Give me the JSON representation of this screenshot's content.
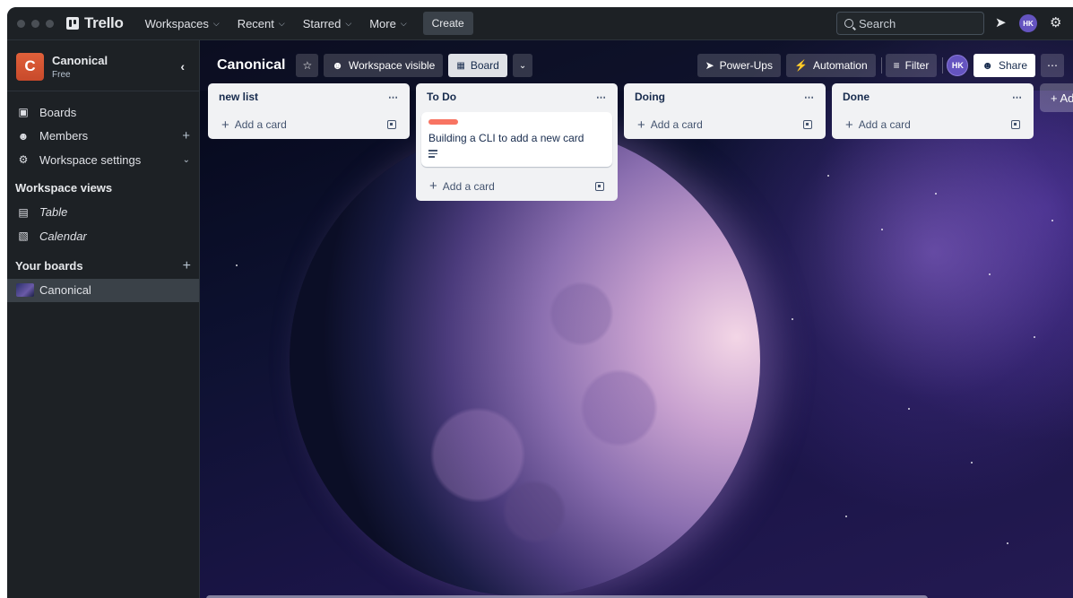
{
  "topnav": {
    "app_name": "Trello",
    "menus": [
      {
        "label": "Workspaces"
      },
      {
        "label": "Recent"
      },
      {
        "label": "Starred"
      },
      {
        "label": "More"
      }
    ],
    "create_label": "Create",
    "search_placeholder": "Search",
    "user_initials": "HK"
  },
  "sidebar": {
    "workspace_name": "Canonical",
    "workspace_initial": "C",
    "workspace_plan": "Free",
    "items": [
      {
        "label": "Boards",
        "icon": "board-icon"
      },
      {
        "label": "Members",
        "icon": "members-icon"
      },
      {
        "label": "Workspace settings",
        "icon": "gear-icon"
      }
    ],
    "views_heading": "Workspace views",
    "views": [
      {
        "label": "Table",
        "icon": "table-icon"
      },
      {
        "label": "Calendar",
        "icon": "calendar-icon"
      }
    ],
    "boards_heading": "Your boards",
    "boards": [
      {
        "label": "Canonical"
      }
    ]
  },
  "board": {
    "title": "Canonical",
    "visibility_label": "Workspace visible",
    "view_label": "Board",
    "powerups_label": "Power-Ups",
    "automation_label": "Automation",
    "filter_label": "Filter",
    "member_initials": "HK",
    "share_label": "Share",
    "add_list_label": "+ Ad",
    "lists": [
      {
        "title": "new list",
        "add_label": "Add a card",
        "cards": []
      },
      {
        "title": "To Do",
        "add_label": "Add a card",
        "cards": [
          {
            "title": "Building a CLI to add a new card",
            "label_color": "#f87462",
            "has_description": true
          }
        ]
      },
      {
        "title": "Doing",
        "add_label": "Add a card",
        "cards": []
      },
      {
        "title": "Done",
        "add_label": "Add a card",
        "cards": []
      }
    ]
  },
  "colors": {
    "nav_bg": "#1d2125",
    "list_bg": "#f1f2f4",
    "card_label": "#f87462",
    "avatar": "#6554c0"
  }
}
